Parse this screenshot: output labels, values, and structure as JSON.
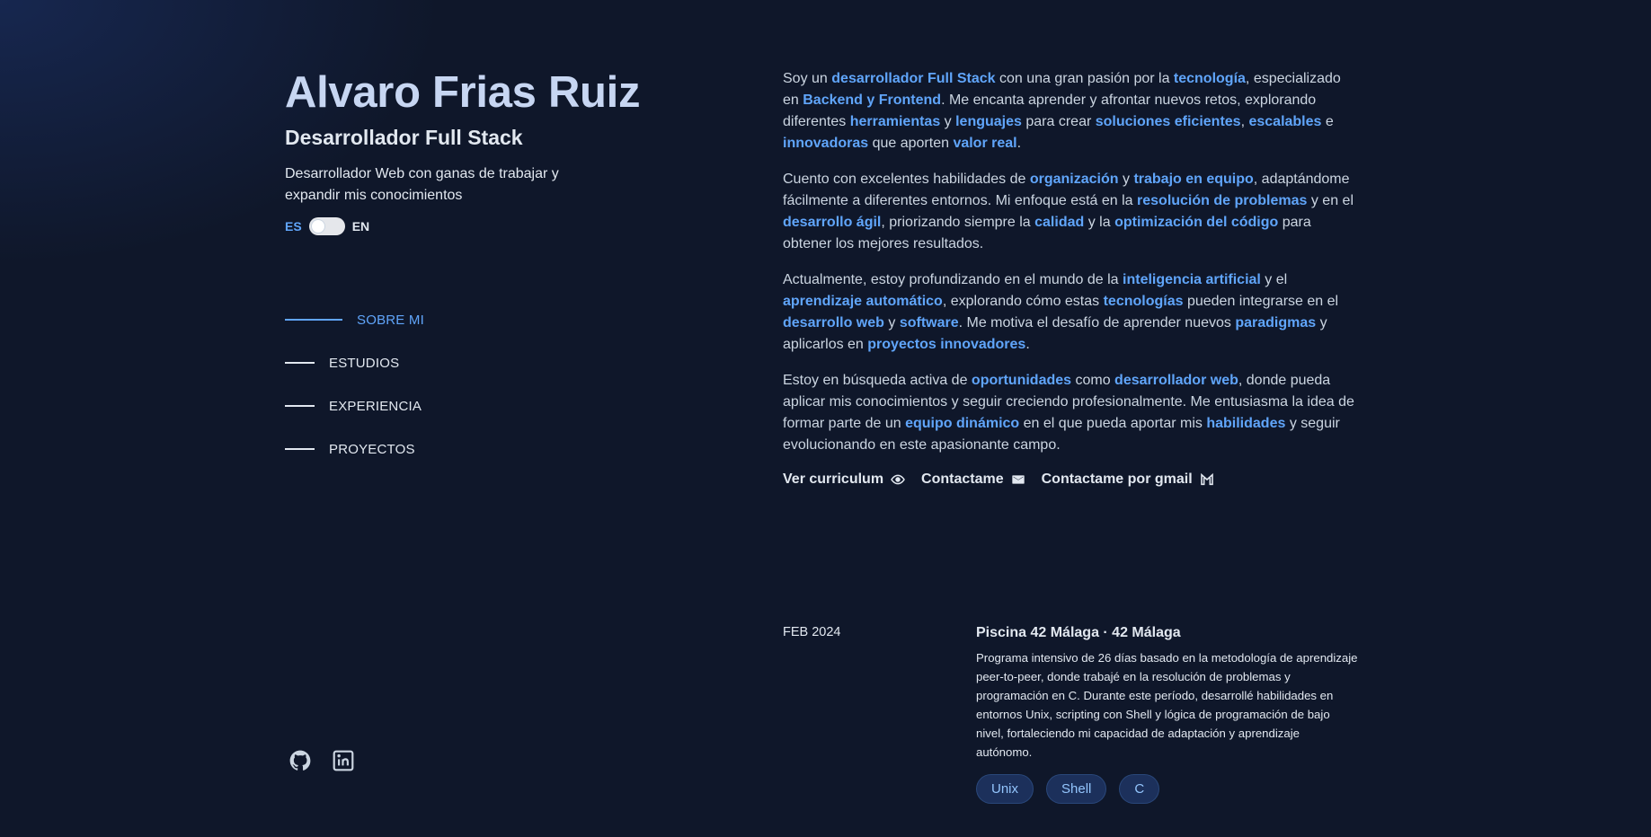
{
  "header": {
    "name": "Alvaro Frias Ruiz",
    "role": "Desarrollador Full Stack",
    "tagline": "Desarrollador Web con ganas de trabajar y expandir mis conocimientos",
    "lang_es": "ES",
    "lang_en": "EN"
  },
  "nav": {
    "items": [
      {
        "label": "SOBRE MI",
        "active": true
      },
      {
        "label": "ESTUDIOS",
        "active": false
      },
      {
        "label": "EXPERIENCIA",
        "active": false
      },
      {
        "label": "PROYECTOS",
        "active": false
      }
    ]
  },
  "social": {
    "icons": [
      "github-icon",
      "linkedin-icon"
    ]
  },
  "about": {
    "paragraphs": [
      [
        {
          "t": "Soy un "
        },
        {
          "t": "desarrollador Full Stack",
          "h": true
        },
        {
          "t": " con una gran pasión por la "
        },
        {
          "t": "tecnología",
          "h": true
        },
        {
          "t": ", especializado en "
        },
        {
          "t": "Backend y Frontend",
          "h": true
        },
        {
          "t": ". Me encanta aprender y afrontar nuevos retos, explorando diferentes "
        },
        {
          "t": "herramientas",
          "h": true
        },
        {
          "t": " y "
        },
        {
          "t": "lenguajes",
          "h": true
        },
        {
          "t": " para crear "
        },
        {
          "t": "soluciones eficientes",
          "h": true
        },
        {
          "t": ", "
        },
        {
          "t": "escalables",
          "h": true
        },
        {
          "t": " e "
        },
        {
          "t": "innovadoras",
          "h": true
        },
        {
          "t": " que aporten "
        },
        {
          "t": "valor real",
          "h": true
        },
        {
          "t": "."
        }
      ],
      [
        {
          "t": "Cuento con excelentes habilidades de "
        },
        {
          "t": "organización",
          "h": true
        },
        {
          "t": " y "
        },
        {
          "t": "trabajo en equipo",
          "h": true
        },
        {
          "t": ", adaptándome fácilmente a diferentes entornos. Mi enfoque está en la "
        },
        {
          "t": "resolución de problemas",
          "h": true
        },
        {
          "t": " y en el "
        },
        {
          "t": "desarrollo ágil",
          "h": true
        },
        {
          "t": ", priorizando siempre la "
        },
        {
          "t": "calidad",
          "h": true
        },
        {
          "t": " y la "
        },
        {
          "t": "optimización del código",
          "h": true
        },
        {
          "t": " para obtener los mejores resultados."
        }
      ],
      [
        {
          "t": "Actualmente, estoy profundizando en el mundo de la "
        },
        {
          "t": "inteligencia artificial",
          "h": true
        },
        {
          "t": " y el "
        },
        {
          "t": "aprendizaje automático",
          "h": true
        },
        {
          "t": ", explorando cómo estas "
        },
        {
          "t": "tecnologías",
          "h": true
        },
        {
          "t": " pueden integrarse en el "
        },
        {
          "t": "desarrollo web",
          "h": true
        },
        {
          "t": " y "
        },
        {
          "t": "software",
          "h": true
        },
        {
          "t": ". Me motiva el desafío de aprender nuevos "
        },
        {
          "t": "paradigmas",
          "h": true
        },
        {
          "t": " y aplicarlos en "
        },
        {
          "t": "proyectos innovadores",
          "h": true
        },
        {
          "t": "."
        }
      ],
      [
        {
          "t": "Estoy en búsqueda activa de "
        },
        {
          "t": "oportunidades",
          "h": true
        },
        {
          "t": " como "
        },
        {
          "t": "desarrollador web",
          "h": true
        },
        {
          "t": ", donde pueda aplicar mis conocimientos y seguir creciendo profesionalmente. Me entusiasma la idea de formar parte de un "
        },
        {
          "t": "equipo dinámico",
          "h": true
        },
        {
          "t": " en el que pueda aportar mis "
        },
        {
          "t": "habilidades",
          "h": true
        },
        {
          "t": " y seguir evolucionando en este apasionante campo."
        }
      ]
    ],
    "actions": {
      "cv": "Ver curriculum",
      "contact": "Contactame",
      "gmail": "Contactame por gmail"
    }
  },
  "education": {
    "date": "FEB 2024",
    "title": "Piscina 42 Málaga · 42 Málaga",
    "description": "Programa intensivo de 26 días basado en la metodología de aprendizaje peer-to-peer, donde trabajé en la resolución de problemas y programación en C. Durante este período, desarrollé habilidades en entornos Unix, scripting con Shell y lógica de programación de bajo nivel, fortaleciendo mi capacidad de adaptación y aprendizaje autónomo.",
    "tags": [
      "Unix",
      "Shell",
      "C"
    ]
  },
  "colors": {
    "background": "#0f172a",
    "accent": "#60a5fa",
    "heading": "#c7d6f2",
    "text": "#cbd5e1"
  }
}
